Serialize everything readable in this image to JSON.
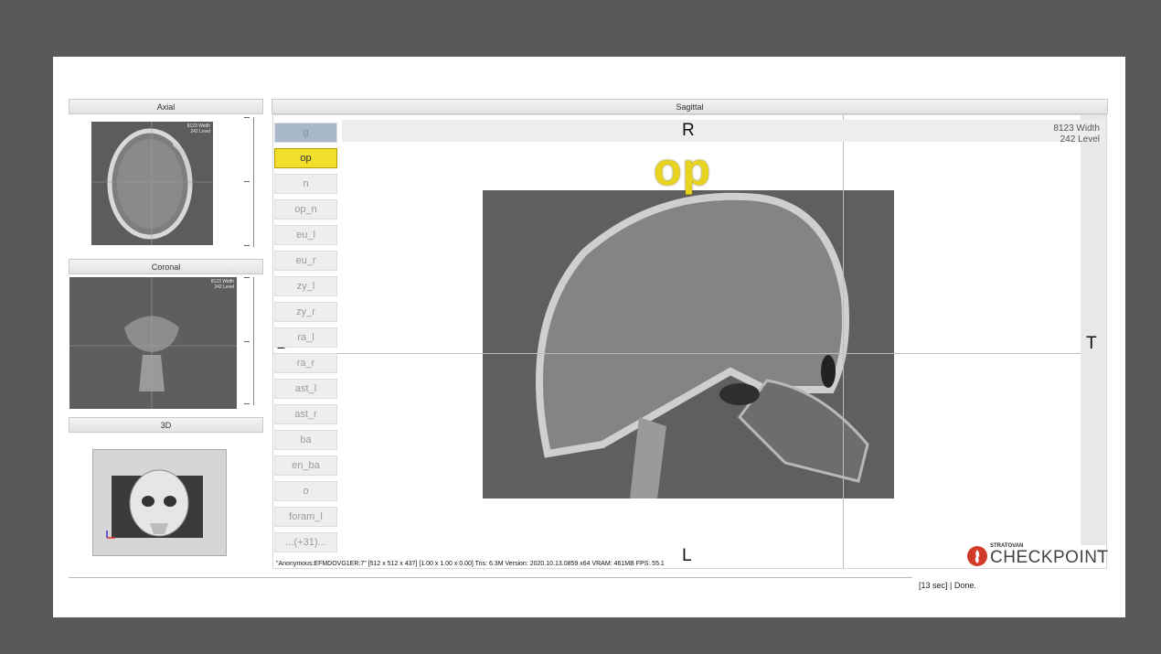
{
  "panels": {
    "axial": {
      "title": "Axial",
      "width_text": "8123 Width",
      "level_text": "242 Level"
    },
    "coronal": {
      "title": "Coronal",
      "width_text": "8123 Width",
      "level_text": "242 Level"
    },
    "three_d": {
      "title": "3D"
    },
    "sagittal": {
      "title": "Sagittal",
      "width_text": "8123 Width",
      "level_text": "242 Level"
    }
  },
  "orientation": {
    "top": "R",
    "bottom": "L",
    "left": "B",
    "right": "T"
  },
  "landmark_overlay": "op",
  "landmarks": [
    {
      "label": "g",
      "state": "done"
    },
    {
      "label": "op",
      "state": "selected"
    },
    {
      "label": "n",
      "state": "pending"
    },
    {
      "label": "op_n",
      "state": "pending"
    },
    {
      "label": "eu_l",
      "state": "pending"
    },
    {
      "label": "eu_r",
      "state": "pending"
    },
    {
      "label": "zy_l",
      "state": "pending"
    },
    {
      "label": "zy_r",
      "state": "pending"
    },
    {
      "label": "ra_l",
      "state": "pending"
    },
    {
      "label": "ra_r",
      "state": "pending"
    },
    {
      "label": "ast_l",
      "state": "pending"
    },
    {
      "label": "ast_r",
      "state": "pending"
    },
    {
      "label": "ba",
      "state": "pending"
    },
    {
      "label": "en_ba",
      "state": "pending"
    },
    {
      "label": "o",
      "state": "pending"
    },
    {
      "label": "foram_l",
      "state": "pending"
    },
    {
      "label": "...(+31)...",
      "state": "pending"
    }
  ],
  "status_bar": {
    "info": "\"Anonymous:EFMDOVG1ER:7\"  [512 x 512 x 437] [1.00 x 1.00 x 0.00] Tris: 6.3M Version: 2020.10.13.0859 x64 VRAM: 461MB  FPS: 55.1",
    "progress": "[13 sec] | Done."
  },
  "logo": {
    "brand_small": "STRATOVAN",
    "brand_name": "CHECKPOINT",
    "trademark": "™"
  },
  "colors": {
    "background": "#595959",
    "selected_landmark": "#f0e02b",
    "overlay_text": "#e8d31e",
    "logo_red": "#d23a2a"
  }
}
